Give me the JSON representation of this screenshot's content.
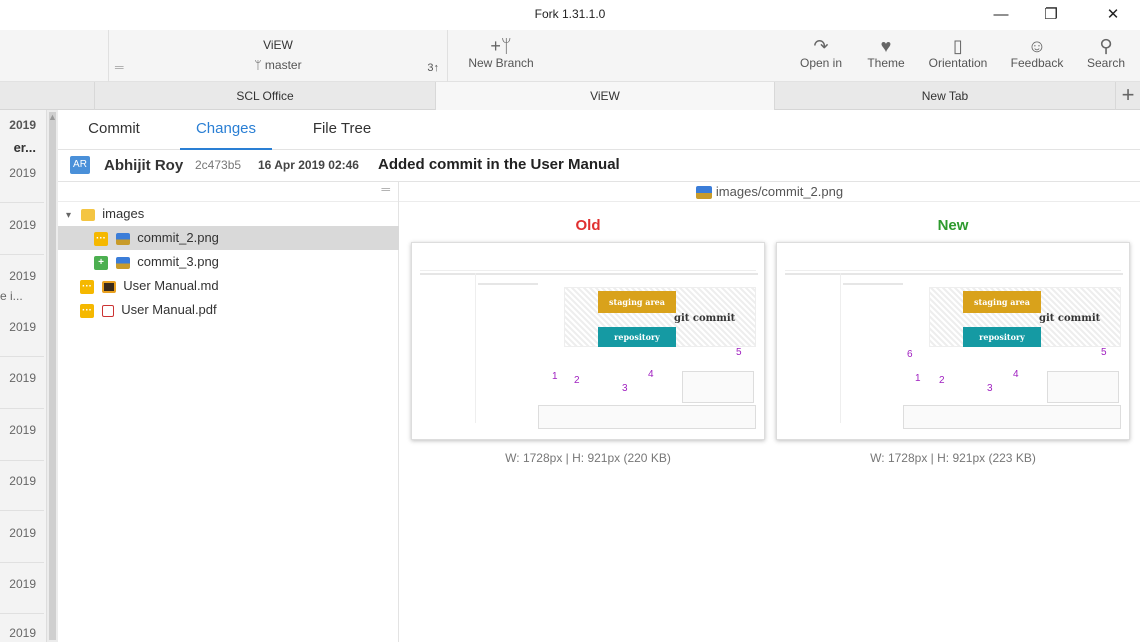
{
  "window": {
    "title": "Fork 1.31.1.0",
    "minimize": "—",
    "maximize": "❐",
    "close": "✕"
  },
  "toolbar": {
    "repo_name": "ViEW",
    "branch_icon": "ᛘ",
    "branch": "master",
    "ahead_count": "3↑",
    "new_branch_icon": "+ᛘ",
    "new_branch_label": "New Branch",
    "open_in_icon": "↷",
    "open_in_label": "Open in",
    "theme_icon": "♥",
    "theme_label": "Theme",
    "orientation_icon": "▯",
    "orientation_label": "Orientation",
    "feedback_icon": "☺",
    "feedback_label": "Feedback",
    "search_icon": "⚲",
    "search_label": "Search"
  },
  "tabs": [
    "SCL Office",
    "ViEW",
    "New Tab"
  ],
  "tab_plus": "+",
  "commit_list_partial": {
    "rows": [
      "2019",
      "er...",
      "2019",
      "2019",
      "2019",
      "e i...",
      "2019",
      "2019",
      "2019",
      "2019",
      "2019",
      "2019",
      "2019"
    ]
  },
  "detail_tabs": [
    "Commit",
    "Changes",
    "File Tree"
  ],
  "commit": {
    "avatar": "AR",
    "author": "Abhijit Roy",
    "sha": "2c473b5",
    "date": "16 Apr 2019 02:46",
    "message": "Added commit in the User Manual"
  },
  "file_tree": {
    "handle": "═",
    "folder_arrow": "▾",
    "folder": "images",
    "files": [
      {
        "name": "commit_2.png",
        "status": "modified",
        "badge": "···"
      },
      {
        "name": "commit_3.png",
        "status": "added",
        "badge": "+"
      },
      {
        "name": "User Manual.md",
        "status": "modified",
        "badge": "···"
      },
      {
        "name": "User Manual.pdf",
        "status": "modified",
        "badge": "···"
      }
    ]
  },
  "diff": {
    "path": "images/commit_2.png",
    "old": {
      "label": "Old",
      "dims": "W: 1728px | H: 921px (220 KB)"
    },
    "new": {
      "label": "New",
      "dims": "W: 1728px | H: 921px (223 KB)"
    },
    "thumb": {
      "staging": "staging area",
      "commit": "git commit",
      "repo": "repository",
      "nums_old": [
        "1",
        "2",
        "3",
        "4",
        "5"
      ],
      "nums_new": [
        "1",
        "2",
        "3",
        "4",
        "5",
        "6"
      ]
    }
  },
  "colors": {
    "old": "#e03030",
    "new": "#2e9a2e",
    "accent": "#2a7fd4",
    "badge_modified": "#f5b800",
    "badge_added": "#4caf50"
  }
}
